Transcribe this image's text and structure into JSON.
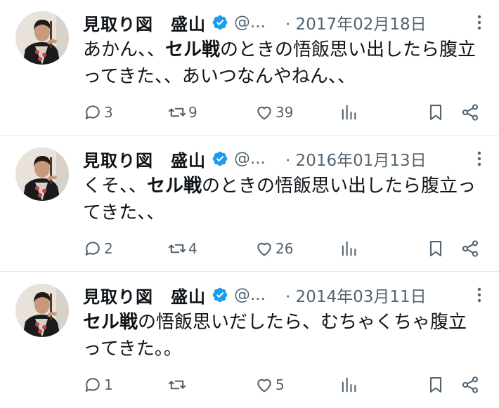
{
  "tweets": [
    {
      "name": "見取り図　盛山",
      "handle": "@...",
      "date": "· 2017年02月18日",
      "text_segments": [
        {
          "text": "あかん、、",
          "bold": false
        },
        {
          "text": "セル戦",
          "bold": true
        },
        {
          "text": "のときの悟飯思い出したら腹立ってきた、、あいつなんやねん、、",
          "bold": false
        }
      ],
      "replies": "3",
      "retweets": "9",
      "likes": "39"
    },
    {
      "name": "見取り図　盛山",
      "handle": "@...",
      "date": "· 2016年01月13日",
      "text_segments": [
        {
          "text": "くそ、、",
          "bold": false
        },
        {
          "text": "セル戦",
          "bold": true
        },
        {
          "text": "のときの悟飯思い出したら腹立ってきた、、",
          "bold": false
        }
      ],
      "replies": "2",
      "retweets": "4",
      "likes": "26"
    },
    {
      "name": "見取り図　盛山",
      "handle": "@...",
      "date": "· 2014年03月11日",
      "text_segments": [
        {
          "text": "セル戦",
          "bold": true
        },
        {
          "text": "の悟飯思いだしたら、むちゃくちゃ腹立ってきた。。",
          "bold": false
        }
      ],
      "replies": "1",
      "retweets": "",
      "likes": "5"
    }
  ],
  "icons": {
    "verified": "verified-badge-icon",
    "more": "more-dots-icon",
    "reply": "reply-bubble-icon",
    "retweet": "retweet-icon",
    "like": "heart-icon",
    "views": "views-bars-icon",
    "bookmark": "bookmark-icon",
    "share": "share-icon"
  },
  "colors": {
    "text": "#0f1419",
    "secondary": "#536471",
    "verified": "#1d9bf0",
    "divider": "#e6e9ec"
  }
}
